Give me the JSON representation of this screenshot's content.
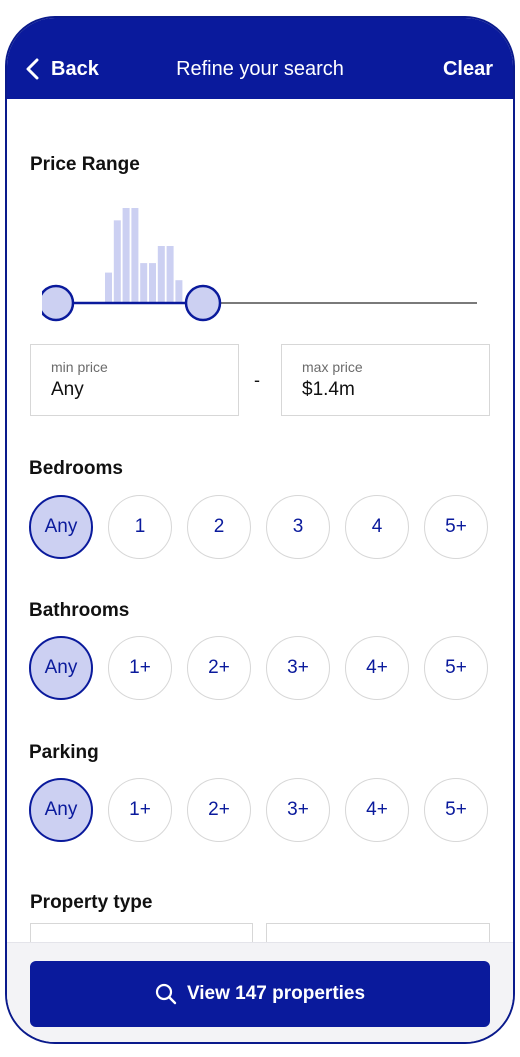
{
  "header": {
    "back_label": "Back",
    "title": "Refine your search",
    "clear_label": "Clear"
  },
  "price": {
    "title": "Price Range",
    "histogram_levels": [
      0.32,
      0.87,
      1.0,
      1.0,
      0.42,
      0.42,
      0.6,
      0.6,
      0.24
    ],
    "min_label": "min price",
    "min_value": "Any",
    "separator": "-",
    "max_label": "max price",
    "max_value": "$1.4m"
  },
  "bedrooms": {
    "title": "Bedrooms",
    "options": [
      "Any",
      "1",
      "2",
      "3",
      "4",
      "5+"
    ],
    "selected": "Any"
  },
  "bathrooms": {
    "title": "Bathrooms",
    "options": [
      "Any",
      "1+",
      "2+",
      "3+",
      "4+",
      "5+"
    ],
    "selected": "Any"
  },
  "parking": {
    "title": "Parking",
    "options": [
      "Any",
      "1+",
      "2+",
      "3+",
      "4+",
      "5+"
    ],
    "selected": "Any"
  },
  "property_type": {
    "title": "Property type"
  },
  "footer": {
    "cta_label": "View 147 properties"
  },
  "colors": {
    "brand": "#0a1a9c",
    "selected_fill": "#ccd0f2",
    "histogram": "#ccd0f2",
    "track": "#7a7a7a"
  }
}
